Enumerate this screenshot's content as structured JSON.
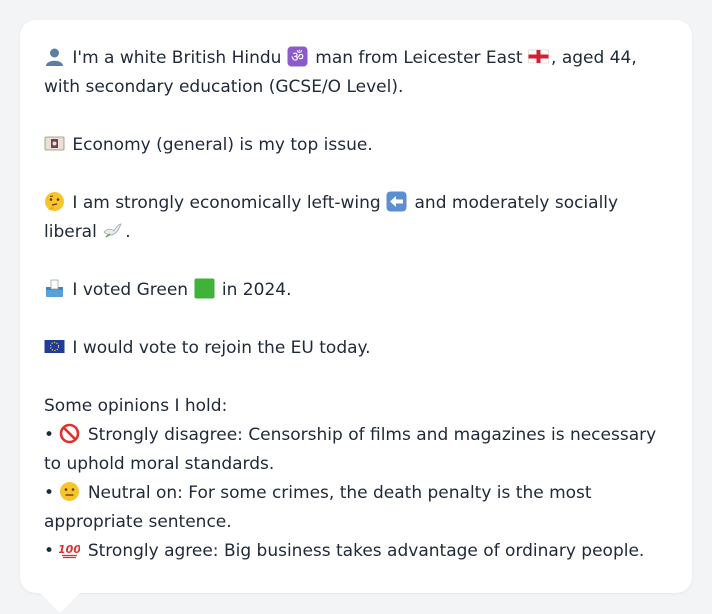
{
  "message": {
    "identity": {
      "icon": "person-silhouette-icon",
      "text_before": "I'm a white British Hindu",
      "icon_om": "om-symbol-icon",
      "text_mid": "man from Leicester East",
      "icon_flag": "england-flag-icon",
      "text_after": ", aged 44, with secondary education (GCSE/O Level)."
    },
    "top_issue": {
      "icon": "money-bill-icon",
      "text": "Economy (general) is my top issue."
    },
    "ideology": {
      "icon": "thinking-face-icon",
      "text_before": "I am strongly economically left-wing",
      "icon_arrow": "left-arrow-icon",
      "text_mid": "and moderately socially liberal",
      "icon_dove": "dove-icon",
      "text_after": "."
    },
    "vote": {
      "icon": "ballot-box-icon",
      "text_before": "I voted Green",
      "icon_square": "green-square-icon",
      "text_after": "in 2024."
    },
    "eu": {
      "icon": "eu-flag-icon",
      "text": "I would vote to rejoin the EU today."
    },
    "opinions_heading": "Some opinions I hold:",
    "opinions": [
      {
        "bullet": "•",
        "icon": "prohibited-icon",
        "text": "Strongly disagree: Censorship of films and magazines is necessary to uphold moral standards."
      },
      {
        "bullet": "•",
        "icon": "neutral-face-icon",
        "text": "Neutral on: For some crimes, the death penalty is the most appropriate sentence."
      },
      {
        "bullet": "•",
        "icon": "hundred-points-icon",
        "text": "Strongly agree: Big business takes advantage of ordinary people."
      }
    ]
  },
  "colors": {
    "background": "#f3f4f6",
    "bubble": "#ffffff",
    "text": "#1f2937"
  }
}
